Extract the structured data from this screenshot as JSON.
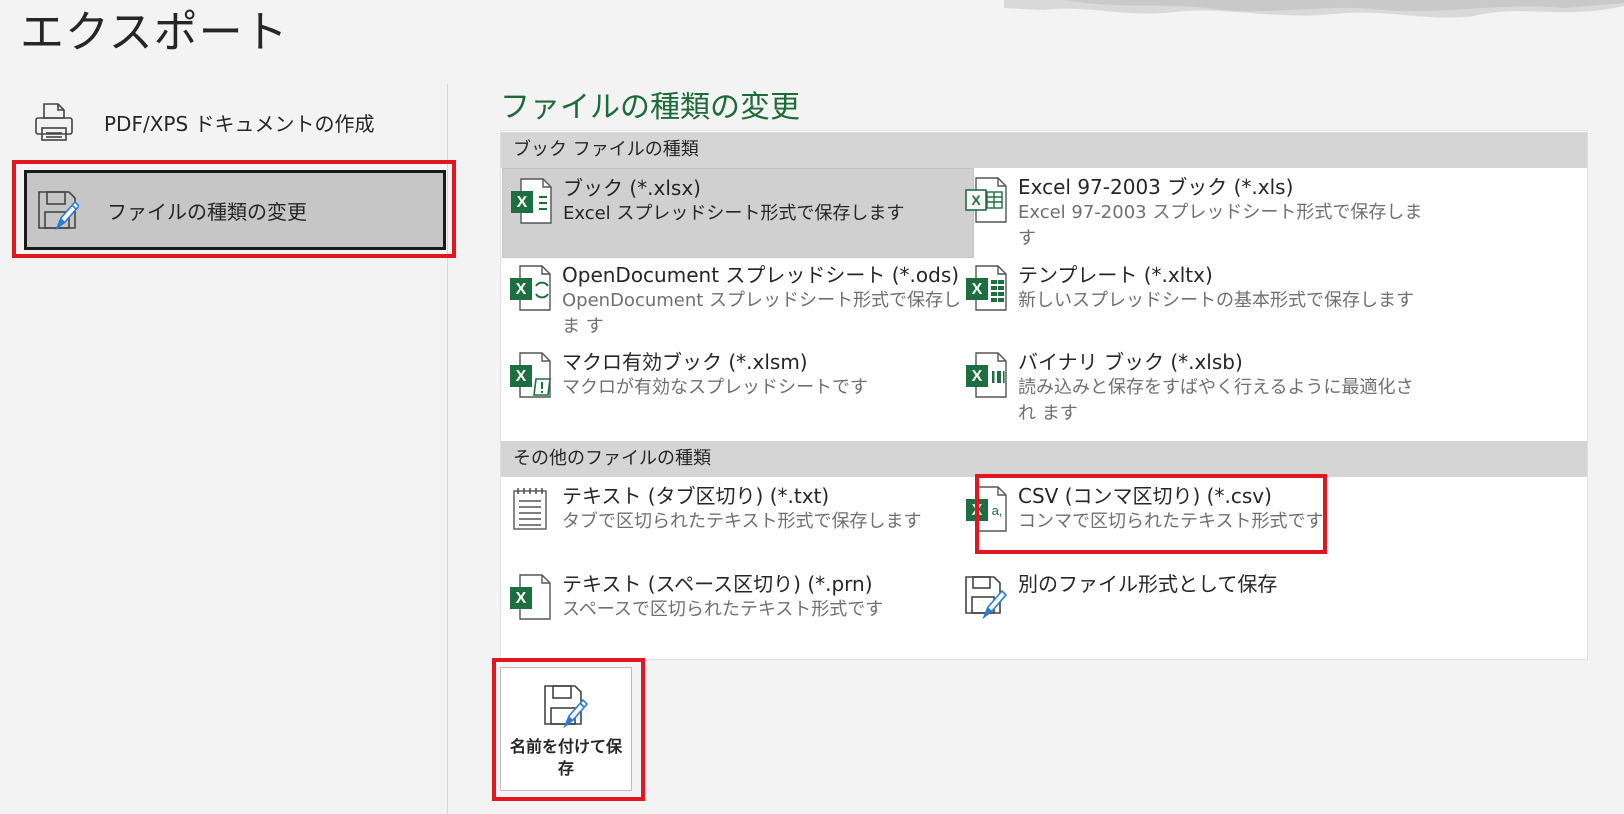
{
  "page": {
    "title": "エクスポート"
  },
  "nav": {
    "items": [
      {
        "id": "pdf",
        "label": "PDF/XPS ドキュメントの作成",
        "icon": "printer-icon"
      },
      {
        "id": "change",
        "label": "ファイルの種類の変更",
        "icon": "save-as-icon",
        "selected": true
      }
    ]
  },
  "main": {
    "title": "ファイルの種類の変更",
    "groups": [
      {
        "header": "ブック ファイルの種類",
        "items": [
          {
            "name": "ブック (*.xlsx)",
            "desc": "Excel スプレッドシート形式で保存します",
            "icon": "excel-xlsx-icon",
            "selected": true
          },
          {
            "name": "Excel 97-2003 ブック (*.xls)",
            "desc": "Excel 97-2003 スプレッドシート形式で保存しま す",
            "icon": "excel-xls-icon"
          },
          {
            "name": "OpenDocument スプレッドシート (*.ods)",
            "desc": "OpenDocument スプレッドシート形式で保存しま す",
            "icon": "excel-ods-icon"
          },
          {
            "name": "テンプレート (*.xltx)",
            "desc": "新しいスプレッドシートの基本形式で保存します",
            "icon": "excel-template-icon"
          },
          {
            "name": "マクロ有効ブック (*.xlsm)",
            "desc": "マクロが有効なスプレッドシートです",
            "icon": "excel-macro-icon"
          },
          {
            "name": "バイナリ ブック (*.xlsb)",
            "desc": "読み込みと保存をすばやく行えるように最適化され ます",
            "icon": "excel-binary-icon"
          }
        ]
      },
      {
        "header": "その他のファイルの種類",
        "items": [
          {
            "name": "テキスト (タブ区切り) (*.txt)",
            "desc": "タブで区切られたテキスト形式で保存します",
            "icon": "text-file-icon"
          },
          {
            "name": "CSV (コンマ区切り) (*.csv)",
            "desc": "コンマで区切られたテキスト形式です",
            "icon": "excel-csv-icon"
          },
          {
            "name": "テキスト (スペース区切り) (*.prn)",
            "desc": "スペースで区切られたテキスト形式です",
            "icon": "excel-prn-icon"
          },
          {
            "name": "別のファイル形式として保存",
            "desc": "",
            "icon": "save-as-icon"
          }
        ]
      }
    ]
  },
  "save_button": {
    "label": "名前を付けて保存",
    "icon": "save-as-icon"
  },
  "colors": {
    "accent_green": "#1e6b3a",
    "excel_green": "#1d6f42",
    "highlight_red": "#e3161f",
    "selected_gray": "#c6c6c6"
  }
}
